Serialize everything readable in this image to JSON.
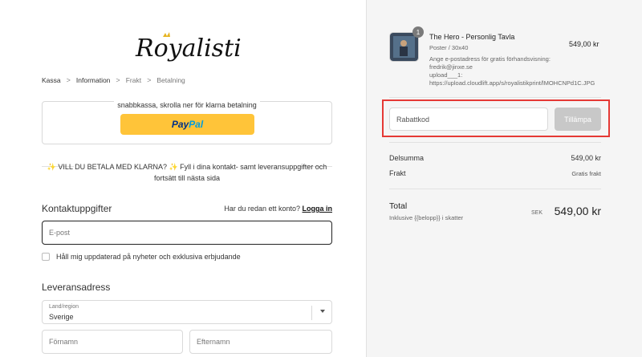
{
  "logo": {
    "text": "Royalistik"
  },
  "breadcrumb": {
    "items": [
      "Kassa",
      "Information",
      "Frakt",
      "Betalning"
    ],
    "separator": ">"
  },
  "express": {
    "title": "snabbkassa, skrolla ner för klarna betalning",
    "paypal_label_1": "Pay",
    "paypal_label_2": "Pal",
    "paypal_color": "#ffc439"
  },
  "klarna_message": "✨ VILL DU BETALA MED KLARNA? ✨ Fyll i dina kontakt- samt leveransuppgifter och fortsätt till nästa sida",
  "contact": {
    "heading": "Kontaktuppgifter",
    "has_account_text": "Har du redan ett konto?",
    "login_link": "Logga in",
    "email_placeholder": "E-post",
    "newsletter_label": "Håll mig uppdaterad på nyheter och exklusiva erbjudande"
  },
  "delivery": {
    "heading": "Leveransadress",
    "country_label": "Land/region",
    "country_value": "Sverige",
    "firstname_placeholder": "Förnamn",
    "lastname_placeholder": "Efternamn"
  },
  "summary": {
    "product": {
      "quantity": "1",
      "title": "The Hero - Personlig Tavla",
      "variant": "Poster / 30x40",
      "property": "Ange e-postadress för gratis förhandsvisning: fredrik@jinxe.se",
      "upload": "upload___1: https://upload.cloudlift.app/s/royalistikprint/lMOHCNPd1C.JPG",
      "price": "549,00 kr"
    },
    "discount_placeholder": "Rabattkod",
    "apply_label": "Tillämpa",
    "subtotal_label": "Delsumma",
    "subtotal_value": "549,00 kr",
    "shipping_label": "Frakt",
    "shipping_value": "Gratis frakt",
    "total_label": "Total",
    "total_sub": "Inklusive {{belopp}} i skatter",
    "currency": "SEK",
    "total_value": "549,00 kr",
    "highlight_color": "#e53935"
  }
}
